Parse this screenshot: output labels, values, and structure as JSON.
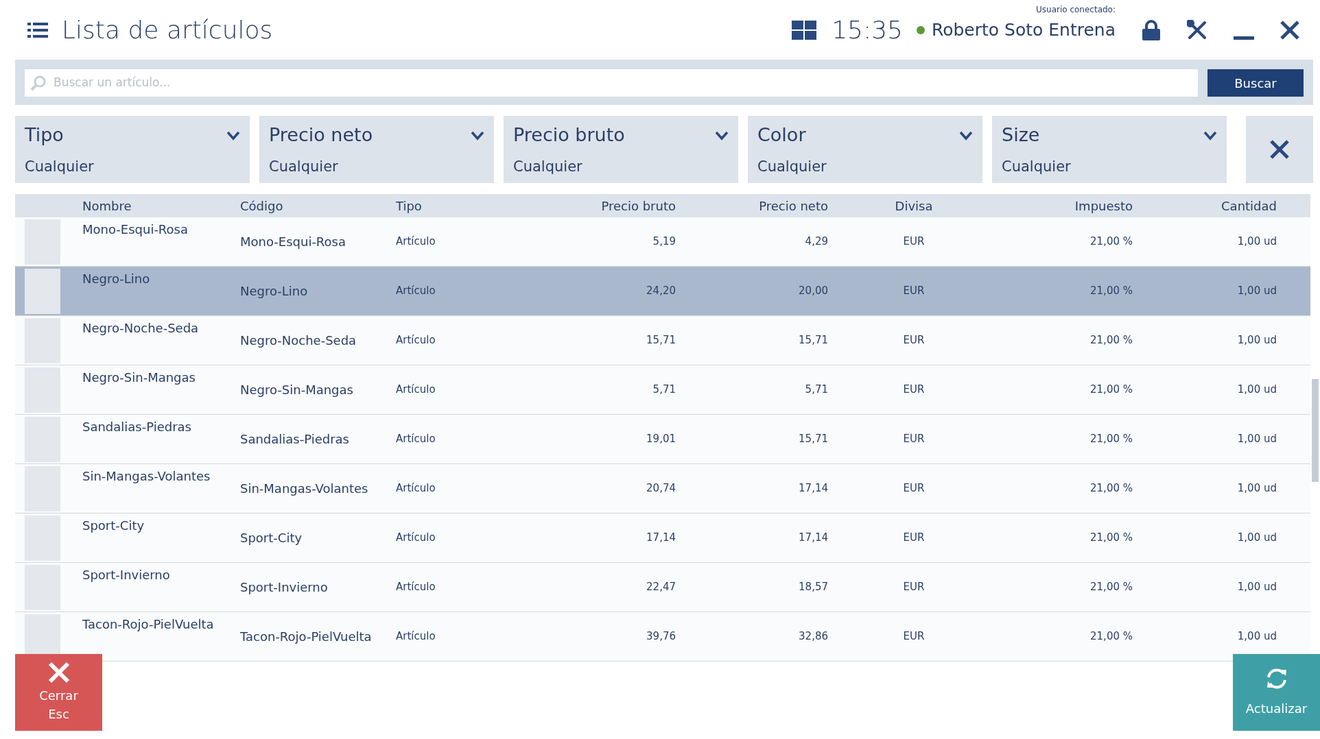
{
  "window": {
    "title": "Lista de artículos",
    "clock": "15:35",
    "user_label": "Usuario conectado:",
    "user": "Roberto Soto Entrena",
    "user_online": true
  },
  "search": {
    "placeholder": "Buscar un artículo...",
    "button": "Buscar"
  },
  "filters": [
    {
      "label": "Tipo",
      "value": "Cualquier"
    },
    {
      "label": "Precio neto",
      "value": "Cualquier"
    },
    {
      "label": "Precio bruto",
      "value": "Cualquier"
    },
    {
      "label": "Color",
      "value": "Cualquier"
    },
    {
      "label": "Size",
      "value": "Cualquier"
    }
  ],
  "table": {
    "columns": [
      "Nombre",
      "Código",
      "Tipo",
      "Precio bruto",
      "Precio neto",
      "Divisa",
      "Impuesto",
      "Cantidad"
    ],
    "rows": [
      {
        "name": "Mono-Esqui-Rosa",
        "code": "Mono-Esqui-Rosa",
        "type": "Artículo",
        "gross": "5,19",
        "net": "4,29",
        "currency": "EUR",
        "tax": "21,00 %",
        "qty": "1,00 ud",
        "selected": false
      },
      {
        "name": "Negro-Lino",
        "code": "Negro-Lino",
        "type": "Artículo",
        "gross": "24,20",
        "net": "20,00",
        "currency": "EUR",
        "tax": "21,00 %",
        "qty": "1,00 ud",
        "selected": true
      },
      {
        "name": "Negro-Noche-Seda",
        "code": "Negro-Noche-Seda",
        "type": "Artículo",
        "gross": "15,71",
        "net": "15,71",
        "currency": "EUR",
        "tax": "21,00 %",
        "qty": "1,00 ud",
        "selected": false
      },
      {
        "name": "Negro-Sin-Mangas",
        "code": "Negro-Sin-Mangas",
        "type": "Artículo",
        "gross": "5,71",
        "net": "5,71",
        "currency": "EUR",
        "tax": "21,00 %",
        "qty": "1,00 ud",
        "selected": false
      },
      {
        "name": "Sandalias-Piedras",
        "code": "Sandalias-Piedras",
        "type": "Artículo",
        "gross": "19,01",
        "net": "15,71",
        "currency": "EUR",
        "tax": "21,00 %",
        "qty": "1,00 ud",
        "selected": false
      },
      {
        "name": "Sin-Mangas-Volantes",
        "code": "Sin-Mangas-Volantes",
        "type": "Artículo",
        "gross": "20,74",
        "net": "17,14",
        "currency": "EUR",
        "tax": "21,00 %",
        "qty": "1,00 ud",
        "selected": false
      },
      {
        "name": "Sport-City",
        "code": "Sport-City",
        "type": "Artículo",
        "gross": "17,14",
        "net": "17,14",
        "currency": "EUR",
        "tax": "21,00 %",
        "qty": "1,00 ud",
        "selected": false
      },
      {
        "name": "Sport-Invierno",
        "code": "Sport-Invierno",
        "type": "Artículo",
        "gross": "22,47",
        "net": "18,57",
        "currency": "EUR",
        "tax": "21,00 %",
        "qty": "1,00 ud",
        "selected": false
      },
      {
        "name": "Tacon-Rojo-PielVuelta",
        "code": "Tacon-Rojo-PielVuelta",
        "type": "Artículo",
        "gross": "39,76",
        "net": "32,86",
        "currency": "EUR",
        "tax": "21,00 %",
        "qty": "1,00 ud",
        "selected": false
      }
    ]
  },
  "buttons": {
    "close": "Cerrar",
    "close_key": "Esc",
    "refresh": "Actualizar"
  }
}
